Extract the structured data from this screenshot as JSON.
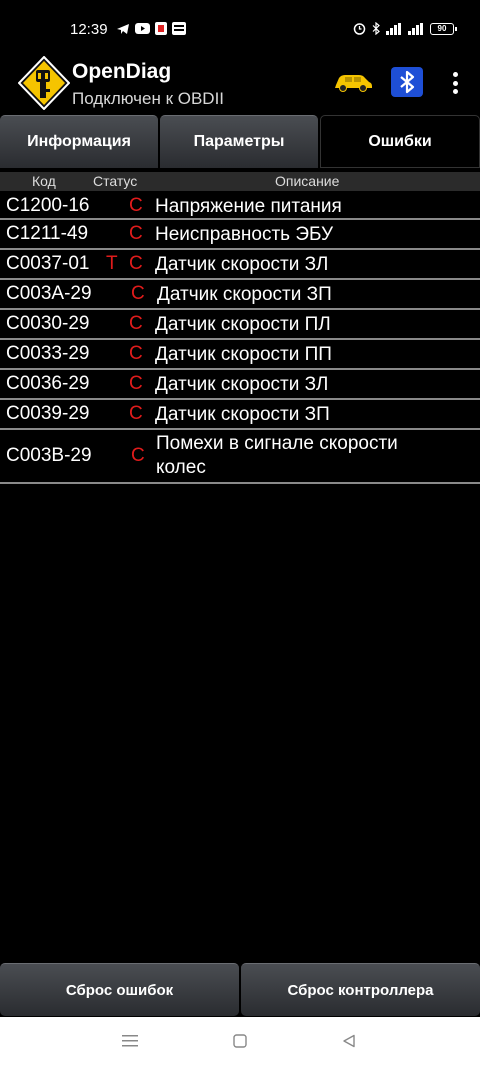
{
  "status_bar": {
    "time": "12:39",
    "battery": "90",
    "network": "4G"
  },
  "app": {
    "title": "OpenDiag",
    "subtitle": "Подключен к OBDII"
  },
  "tabs": [
    {
      "label": "Информация",
      "active": false
    },
    {
      "label": "Параметры",
      "active": false
    },
    {
      "label": "Ошибки",
      "active": true
    }
  ],
  "table": {
    "headers": {
      "code": "Код",
      "status": "Статус",
      "description": "Описание"
    },
    "rows": [
      {
        "code": "C1200-16",
        "status": "C",
        "description": "Напряжение питания"
      },
      {
        "code": "C1211-49",
        "status": "C",
        "description": "Неисправность ЭБУ"
      },
      {
        "code": "C0037-01",
        "status_t": "T",
        "status": "C",
        "description": "Датчик скорости ЗЛ"
      },
      {
        "code": "C003A-29",
        "status": "C",
        "description": "Датчик скорости ЗП"
      },
      {
        "code": "C0030-29",
        "status": "C",
        "description": "Датчик скорости ПЛ"
      },
      {
        "code": "C0033-29",
        "status": "C",
        "description": "Датчик скорости ПП"
      },
      {
        "code": "C0036-29",
        "status": "C",
        "description": "Датчик скорости ЗЛ"
      },
      {
        "code": "C0039-29",
        "status": "C",
        "description": "Датчик скорости ЗП"
      },
      {
        "code": "C003B-29",
        "status": "C",
        "description": "Помехи в сигнале скорости колес"
      }
    ]
  },
  "buttons": {
    "reset_errors": "Сброс ошибок",
    "reset_controller": "Сброс контроллера"
  },
  "colors": {
    "status_red": "#e01b1b",
    "bluetooth_blue": "#1e4fd6",
    "logo_yellow": "#f5c400",
    "car_yellow": "#f5c400"
  }
}
